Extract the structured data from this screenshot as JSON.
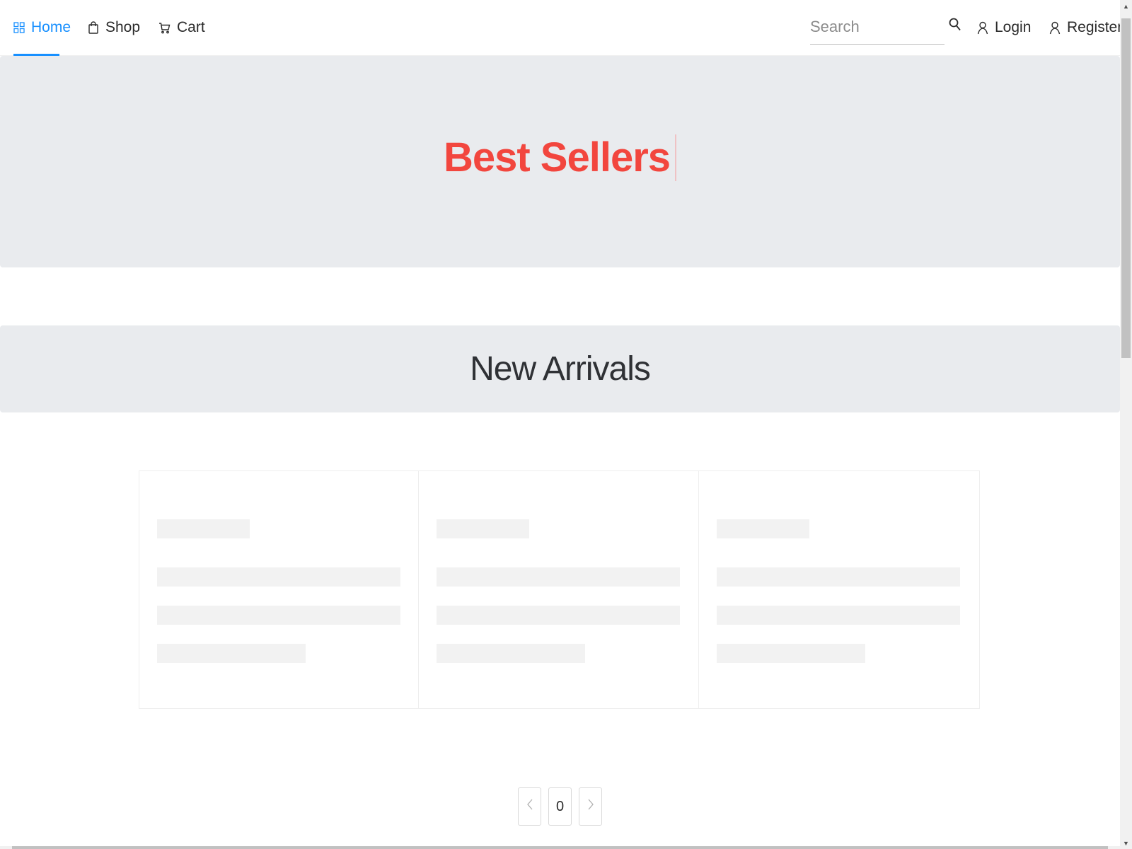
{
  "nav": {
    "home_label": "Home",
    "shop_label": "Shop",
    "cart_label": "Cart",
    "login_label": "Login",
    "register_label": "Register",
    "active_item": "Home",
    "accent_color": "#1890ff"
  },
  "search": {
    "placeholder": "Search",
    "value": ""
  },
  "hero": {
    "title": "Best Sellers",
    "title_color": "#f2463e"
  },
  "arrivals": {
    "title": "New Arrivals"
  },
  "products": {
    "loading": true,
    "skeleton_cards": 3
  },
  "pagination": {
    "current_page": "0",
    "prev_icon": "chevron-left-icon",
    "next_icon": "chevron-right-icon"
  },
  "icons": {
    "home": "appstore-icon",
    "shop": "shopping-bag-icon",
    "cart": "shopping-cart-icon",
    "search": "search-icon",
    "login": "user-icon",
    "register": "user-icon"
  }
}
